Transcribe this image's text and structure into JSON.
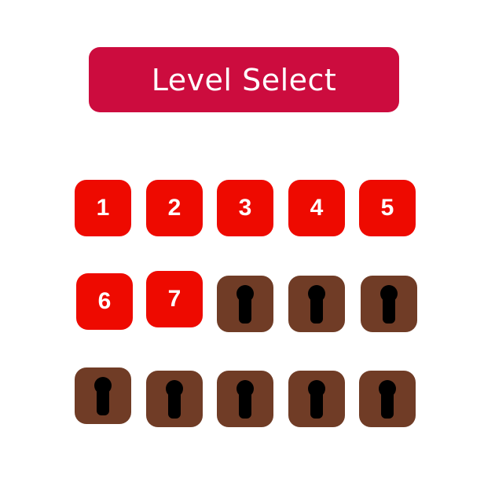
{
  "title": "Level Select",
  "colors": {
    "banner": "#cc0c3e",
    "unlocked": "#ee0a00",
    "locked": "#703c26",
    "keyhole": "#000000",
    "text": "#ffffff"
  },
  "levels": [
    {
      "label": "1",
      "locked": false,
      "icon": ""
    },
    {
      "label": "2",
      "locked": false,
      "icon": ""
    },
    {
      "label": "3",
      "locked": false,
      "icon": ""
    },
    {
      "label": "4",
      "locked": false,
      "icon": ""
    },
    {
      "label": "5",
      "locked": false,
      "icon": ""
    },
    {
      "label": "6",
      "locked": false,
      "icon": ""
    },
    {
      "label": "7",
      "locked": false,
      "icon": ""
    },
    {
      "label": "",
      "locked": true,
      "icon": "keyhole-lock-icon"
    },
    {
      "label": "",
      "locked": true,
      "icon": "keyhole-lock-icon"
    },
    {
      "label": "",
      "locked": true,
      "icon": "keyhole-lock-icon"
    },
    {
      "label": "",
      "locked": true,
      "icon": "keyhole-lock-icon"
    },
    {
      "label": "",
      "locked": true,
      "icon": "keyhole-lock-icon"
    },
    {
      "label": "",
      "locked": true,
      "icon": "keyhole-lock-icon"
    },
    {
      "label": "",
      "locked": true,
      "icon": "keyhole-lock-icon"
    },
    {
      "label": "",
      "locked": true,
      "icon": "keyhole-lock-icon"
    }
  ]
}
